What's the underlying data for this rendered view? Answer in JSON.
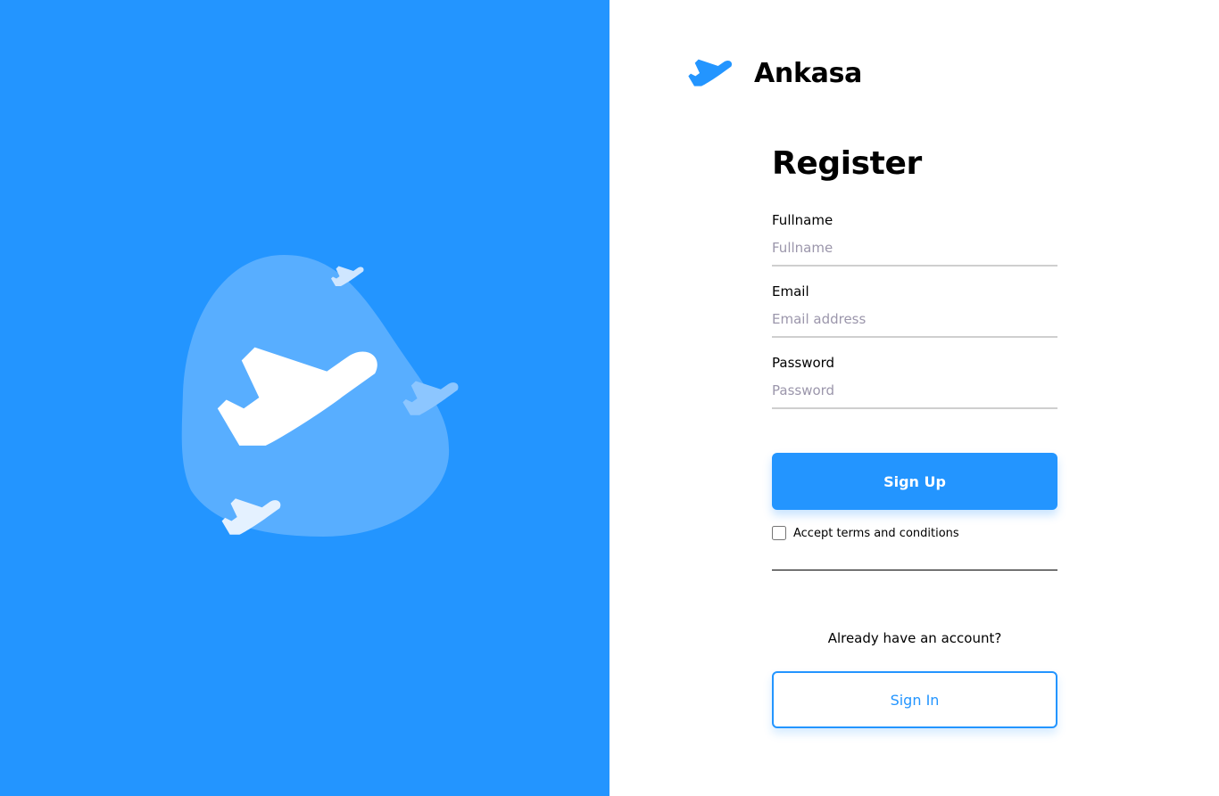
{
  "colors": {
    "primary": "#2395ff",
    "blob": "#58aeff",
    "input_border": "#cfcfcf",
    "placeholder": "#9b96ab"
  },
  "hero": {
    "icons": [
      "plane-icon",
      "plane-icon",
      "plane-icon",
      "plane-icon"
    ]
  },
  "brand": {
    "name": "Ankasa",
    "icon": "plane-icon"
  },
  "form": {
    "title": "Register",
    "fields": [
      {
        "label": "Fullname",
        "placeholder": "Fullname",
        "value": ""
      },
      {
        "label": "Email",
        "placeholder": "Email address",
        "value": ""
      },
      {
        "label": "Password",
        "placeholder": "Password",
        "value": ""
      }
    ],
    "signup_label": "Sign Up",
    "terms_label": "Accept terms and conditions",
    "terms_checked": false,
    "account_prompt": "Already have an account?",
    "signin_label": "Sign In"
  }
}
